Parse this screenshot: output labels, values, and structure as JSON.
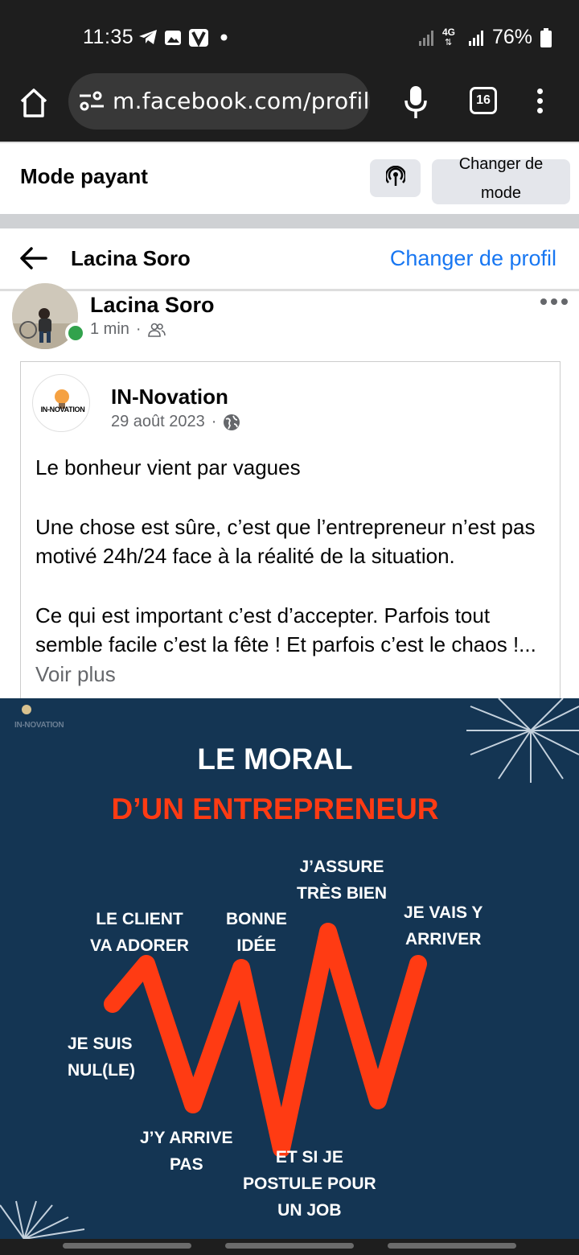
{
  "status_bar": {
    "time": "11:35",
    "network": "4G",
    "battery": "76%",
    "icons": [
      "telegram-icon",
      "gallery-icon",
      "app-v-icon",
      "dot-icon",
      "signal-icon",
      "signal-4g-icon",
      "battery-icon"
    ]
  },
  "browser": {
    "url": "m.facebook.com/profile",
    "tab_count": "16"
  },
  "mode_bar": {
    "title": "Mode payant",
    "change_mode_label_line1": "Changer de",
    "change_mode_label_line2": "mode"
  },
  "profile_header": {
    "name": "Lacina Soro",
    "switch_profile": "Changer de profil"
  },
  "post": {
    "author": "Lacina Soro",
    "time": "1 min",
    "separator": "·",
    "shared": {
      "page_name": "IN-Novation",
      "logo_text": "IN-NOVATION",
      "date": "29 août 2023",
      "separator": "·",
      "paragraph1": "Le bonheur vient par vagues",
      "paragraph2": "Une chose est sûre, c’est que l’entrepreneur n’est pas motivé 24h/24 face à la réalité de la situation.",
      "paragraph3": "Ce qui est important c’est d’accepter. Parfois tout semble facile c’est la fête !  Et parfois c’est le chaos !...",
      "see_more": " Voir plus"
    },
    "image": {
      "brand": "IN-NOVATION",
      "title1": "LE MORAL",
      "title2": "D’UN ENTREPRENEUR",
      "labels": {
        "je_suis_1": "JE SUIS",
        "je_suis_2": "NUL(LE)",
        "client_1": "LE CLIENT",
        "client_2": "VA ADORER",
        "jy_1": "J’Y ARRIVE",
        "jy_2": "PAS",
        "bonne_1": "BONNE",
        "bonne_2": "IDÉE",
        "etsi_1": "ET SI JE",
        "etsi_2": "POSTULE POUR",
        "etsi_3": "UN JOB",
        "assure_1": "J’ASSURE",
        "assure_2": "TRÈS BIEN",
        "vais_1": "JE VAIS Y",
        "vais_2": "ARRIVER"
      },
      "colors": {
        "background": "#143553",
        "accent": "#ff3b13",
        "text": "#ffffff"
      }
    }
  },
  "colors": {
    "facebook_blue": "#1877f2",
    "online_green": "#31a24c",
    "meta_gray": "#65676b"
  }
}
